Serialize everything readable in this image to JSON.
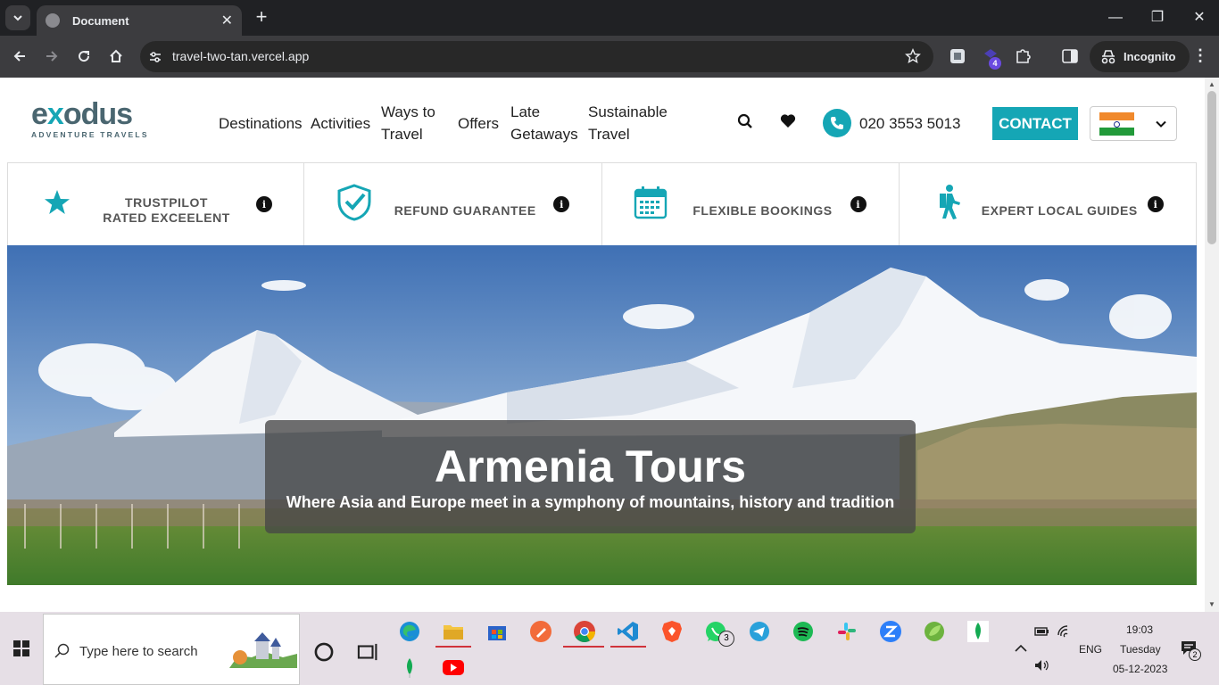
{
  "browser": {
    "tab_title": "Document",
    "url": "travel-two-tan.vercel.app",
    "incognito_label": "Incognito",
    "extension_badge": "4"
  },
  "site": {
    "logo_word_start": "e",
    "logo_word_x": "x",
    "logo_word_end": "odus",
    "logo_sub": "ADVENTURE TRAVELS",
    "nav": [
      {
        "label": "Destinations"
      },
      {
        "label": "Activities"
      },
      {
        "label": "Ways to",
        "label2": "Travel"
      },
      {
        "label": "Offers"
      },
      {
        "label": "Late",
        "label2": "Getaways"
      },
      {
        "label": "Sustainable",
        "label2": "Travel"
      }
    ],
    "phone": "020 3553 5013",
    "contact_label": "CONTACT",
    "country_flag": "india-flag"
  },
  "features": [
    {
      "line1": "TRUSTPILOT",
      "line2": "RATED EXCEELENT",
      "icon": "star-icon"
    },
    {
      "line1": "REFUND GUARANTEE",
      "icon": "shield-check-icon"
    },
    {
      "line1": "FLEXIBLE BOOKINGS",
      "icon": "calendar-icon"
    },
    {
      "line1": "EXPERT LOCAL GUIDES",
      "icon": "hiker-icon"
    }
  ],
  "hero": {
    "title": "Armenia Tours",
    "subtitle": "Where Asia and Europe meet in a symphony of mountains, history and tradition"
  },
  "taskbar": {
    "search_placeholder": "Type here to search",
    "whatsapp_badge": "3",
    "language": "ENG",
    "time": "19:03",
    "day": "Tuesday",
    "date": "05-12-2023",
    "notification_count": "2"
  },
  "colors": {
    "brand_teal": "#15a6b5",
    "logo_gray": "#4a6670"
  }
}
